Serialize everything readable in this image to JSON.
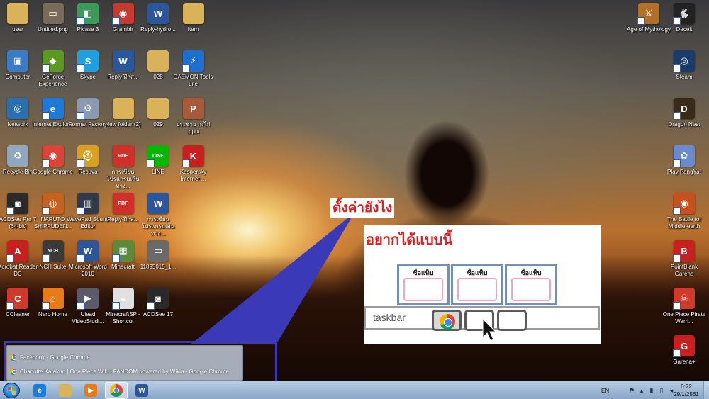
{
  "desktop": {
    "icons_left": [
      {
        "label": "user",
        "name": "user-folder-icon",
        "color": "#d9b25a",
        "glyph": "",
        "col": 0,
        "row": 0,
        "shortcut": false
      },
      {
        "label": "Untitled.png",
        "name": "png-image-icon",
        "color": "#7a6a5a",
        "glyph": "▭",
        "col": 1,
        "row": 0,
        "shortcut": false
      },
      {
        "label": "Picasa 3",
        "name": "picasa-icon",
        "color": "#3b9a5a",
        "glyph": "◧",
        "col": 2,
        "row": 0,
        "shortcut": true
      },
      {
        "label": "Gramblr",
        "name": "gramblr-camera-icon",
        "color": "#c23b2e",
        "glyph": "◉",
        "col": 3,
        "row": 0,
        "shortcut": true
      },
      {
        "label": "Reply-hydro...",
        "name": "word-document-icon",
        "color": "#2b579a",
        "glyph": "W",
        "col": 4,
        "row": 0,
        "shortcut": false
      },
      {
        "label": "Item",
        "name": "item-folder-icon",
        "color": "#d9b25a",
        "glyph": "",
        "col": 5,
        "row": 0,
        "shortcut": false
      },
      {
        "label": "Computer",
        "name": "computer-icon",
        "color": "#3a7bc8",
        "glyph": "▣",
        "col": 0,
        "row": 1,
        "shortcut": false
      },
      {
        "label": "GeForce Experience",
        "name": "geforce-experience-icon",
        "color": "#5a9a1e",
        "glyph": "◆",
        "col": 1,
        "row": 1,
        "shortcut": true
      },
      {
        "label": "Skype",
        "name": "skype-icon",
        "color": "#1ea0e0",
        "glyph": "S",
        "col": 2,
        "row": 1,
        "shortcut": true
      },
      {
        "label": "Reply-ฝึกส...",
        "name": "word-document-icon",
        "color": "#2b579a",
        "glyph": "W",
        "col": 3,
        "row": 1,
        "shortcut": false
      },
      {
        "label": "028",
        "name": "folder-028-icon",
        "color": "#d9b25a",
        "glyph": "",
        "col": 4,
        "row": 1,
        "shortcut": false
      },
      {
        "label": "DAEMON Tools Lite",
        "name": "daemon-tools-icon",
        "color": "#1e6fd0",
        "glyph": "⚡",
        "col": 5,
        "row": 1,
        "shortcut": true
      },
      {
        "label": "Network",
        "name": "network-icon",
        "color": "#2a6fb0",
        "glyph": "◎",
        "col": 0,
        "row": 2,
        "shortcut": false
      },
      {
        "label": "Internet Explor...",
        "name": "internet-explorer-icon",
        "color": "#1e7ad8",
        "glyph": "e",
        "col": 1,
        "row": 2,
        "shortcut": true
      },
      {
        "label": "Format Factory",
        "name": "format-factory-icon",
        "color": "#8a9ab0",
        "glyph": "⚙",
        "col": 2,
        "row": 2,
        "shortcut": true
      },
      {
        "label": "New folder (2)",
        "name": "new-folder-icon",
        "color": "#d9b25a",
        "glyph": "",
        "col": 3,
        "row": 2,
        "shortcut": false
      },
      {
        "label": "029",
        "name": "folder-029-icon",
        "color": "#d9b25a",
        "glyph": "",
        "col": 4,
        "row": 2,
        "shortcut": false
      },
      {
        "label": "ประชาย กงไก่ .pptx",
        "name": "powerpoint-file-icon",
        "color": "#a85a3a",
        "glyph": "P",
        "col": 5,
        "row": 2,
        "shortcut": false
      },
      {
        "label": "Recycle Bin",
        "name": "recycle-bin-icon",
        "color": "#8fa7bf",
        "glyph": "♻",
        "col": 0,
        "row": 3,
        "shortcut": false
      },
      {
        "label": "Google Chrome",
        "name": "google-chrome-icon",
        "color": "#db4437",
        "glyph": "◉",
        "col": 1,
        "row": 3,
        "shortcut": true
      },
      {
        "label": "Recuva",
        "name": "recuva-icon",
        "color": "#d9a020",
        "glyph": "⛑",
        "col": 2,
        "row": 3,
        "shortcut": true
      },
      {
        "label": "การเขียนโปรแกรมเส้นทาง...",
        "name": "pdf-file-icon",
        "color": "#d0302a",
        "glyph": "PDF",
        "col": 3,
        "row": 3,
        "shortcut": false
      },
      {
        "label": "LINE",
        "name": "line-app-icon",
        "color": "#00b900",
        "glyph": "LINE",
        "col": 4,
        "row": 3,
        "shortcut": true
      },
      {
        "label": "Kaspersky Internet ...",
        "name": "kaspersky-icon",
        "color": "#c8201e",
        "glyph": "K",
        "col": 5,
        "row": 3,
        "shortcut": true
      },
      {
        "label": "ACDSee Pro 7 (64-bit)",
        "name": "acdsee-pro-icon",
        "color": "#2a2a2a",
        "glyph": "◙",
        "col": 0,
        "row": 4,
        "shortcut": true
      },
      {
        "label": "NARUTO SHIPPUDEN...",
        "name": "naruto-game-icon",
        "color": "#c8601e",
        "glyph": "◍",
        "col": 1,
        "row": 4,
        "shortcut": true
      },
      {
        "label": "WavePad Sound Editor",
        "name": "wavepad-icon",
        "color": "#303a4a",
        "glyph": "▥",
        "col": 2,
        "row": 4,
        "shortcut": true
      },
      {
        "label": "Reply-ฝึกส...",
        "name": "pdf-file-icon",
        "color": "#d0302a",
        "glyph": "PDF",
        "col": 3,
        "row": 4,
        "shortcut": false
      },
      {
        "label": "การเขียนโปรแกรมเส้นทาง...",
        "name": "word-document-icon",
        "color": "#2b579a",
        "glyph": "W",
        "col": 4,
        "row": 4,
        "shortcut": false
      },
      {
        "label": "Acrobat Reader DC",
        "name": "acrobat-reader-icon",
        "color": "#c8201e",
        "glyph": "A",
        "col": 0,
        "row": 5,
        "shortcut": true
      },
      {
        "label": "NCH Suite",
        "name": "nch-suite-icon",
        "color": "#3a3a3a",
        "glyph": "NCH",
        "col": 1,
        "row": 5,
        "shortcut": true
      },
      {
        "label": "Microsoft Word 2010",
        "name": "microsoft-word-icon",
        "color": "#2b579a",
        "glyph": "W",
        "col": 2,
        "row": 5,
        "shortcut": true
      },
      {
        "label": "Minecraft",
        "name": "minecraft-icon",
        "color": "#5a8a3a",
        "glyph": "▦",
        "col": 3,
        "row": 5,
        "shortcut": true
      },
      {
        "label": "11895015_1...",
        "name": "image-file-icon",
        "color": "#6a6a6a",
        "glyph": "▭",
        "col": 4,
        "row": 5,
        "shortcut": false
      },
      {
        "label": "CCleaner",
        "name": "ccleaner-icon",
        "color": "#d03a2a",
        "glyph": "C",
        "col": 0,
        "row": 6,
        "shortcut": true
      },
      {
        "label": "Nero Home",
        "name": "nero-home-icon",
        "color": "#e87a1a",
        "glyph": "⌂",
        "col": 1,
        "row": 6,
        "shortcut": true
      },
      {
        "label": "Ulead VideoStudi...",
        "name": "ulead-videostudio-icon",
        "color": "#5a5a6a",
        "glyph": "▶",
        "col": 2,
        "row": 6,
        "shortcut": true
      },
      {
        "label": "MinecraftSP - Shortcut",
        "name": "java-file-icon",
        "color": "#e0e0e0",
        "glyph": "☕",
        "col": 3,
        "row": 6,
        "shortcut": true
      },
      {
        "label": "ACDSee 17",
        "name": "acdsee-17-icon",
        "color": "#2a2a2a",
        "glyph": "◙",
        "col": 4,
        "row": 6,
        "shortcut": true
      }
    ],
    "icons_right": [
      {
        "label": "Age of Mythology",
        "name": "age-of-mythology-icon",
        "color": "#b0702a",
        "glyph": "⚔",
        "col": 0,
        "row": 0,
        "shortcut": true
      },
      {
        "label": "Deceit",
        "name": "deceit-icon",
        "color": "#222222",
        "glyph": "🐇",
        "col": 1,
        "row": 0,
        "shortcut": true
      },
      {
        "label": "Steam",
        "name": "steam-icon",
        "color": "#1b3b6a",
        "glyph": "◎",
        "col": 1,
        "row": 1,
        "shortcut": true
      },
      {
        "label": "Dragon Nest",
        "name": "dragon-nest-icon",
        "color": "#3a2a1a",
        "glyph": "D",
        "col": 1,
        "row": 2,
        "shortcut": true
      },
      {
        "label": "Play PangYa!",
        "name": "pangya-icon",
        "color": "#6a8ad0",
        "glyph": "✿",
        "col": 1,
        "row": 3,
        "shortcut": true
      },
      {
        "label": "The Battle for Middle-earth",
        "name": "battle-middle-earth-icon",
        "color": "#c8501e",
        "glyph": "◉",
        "col": 1,
        "row": 4,
        "shortcut": true
      },
      {
        "label": "PointBlank Garena",
        "name": "pointblank-icon",
        "color": "#c8201e",
        "glyph": "B",
        "col": 1,
        "row": 5,
        "shortcut": true
      },
      {
        "label": "One Piece Pirate Warri...",
        "name": "one-piece-icon",
        "color": "#d03a2a",
        "glyph": "☠",
        "col": 1,
        "row": 6,
        "shortcut": true
      },
      {
        "label": "Garena+",
        "name": "garena-plus-icon",
        "color": "#c8201e",
        "glyph": "G",
        "col": 1,
        "row": 7,
        "shortcut": true
      }
    ]
  },
  "popup": {
    "items": [
      "Facebook - Google Chrome",
      "Charlotte Katakuri | One Piece Wiki | FANDOM powered by Wikia - Google Chrome"
    ]
  },
  "annotation": {
    "question": "ตั้งค่ายังไง",
    "wanted_title": "อยากได้แบบนี้",
    "tab_name": "ชื่อแท็บ",
    "taskbar_label": "taskbar"
  },
  "taskbar": {
    "apps": [
      {
        "name": "taskbar-ie-icon",
        "glyph": "e",
        "color": "#1e7ad8",
        "active": false
      },
      {
        "name": "taskbar-explorer-icon",
        "glyph": "",
        "color": "#d9b25a",
        "active": false
      },
      {
        "name": "taskbar-media-player-icon",
        "glyph": "▶",
        "color": "#e87a1a",
        "active": false
      },
      {
        "name": "taskbar-chrome-icon",
        "glyph": "",
        "color": "#db4437",
        "active": true
      },
      {
        "name": "taskbar-word-icon",
        "glyph": "W",
        "color": "#2b579a",
        "active": false
      }
    ],
    "language": "EN",
    "time": "0:22",
    "date": "29/1/2561"
  },
  "colors": {
    "annotation_red": "#e21d1d",
    "callout_blue": "#3a3ab8",
    "tab_border": "#6f8fbf",
    "tab_inner": "#f0a6c0"
  }
}
